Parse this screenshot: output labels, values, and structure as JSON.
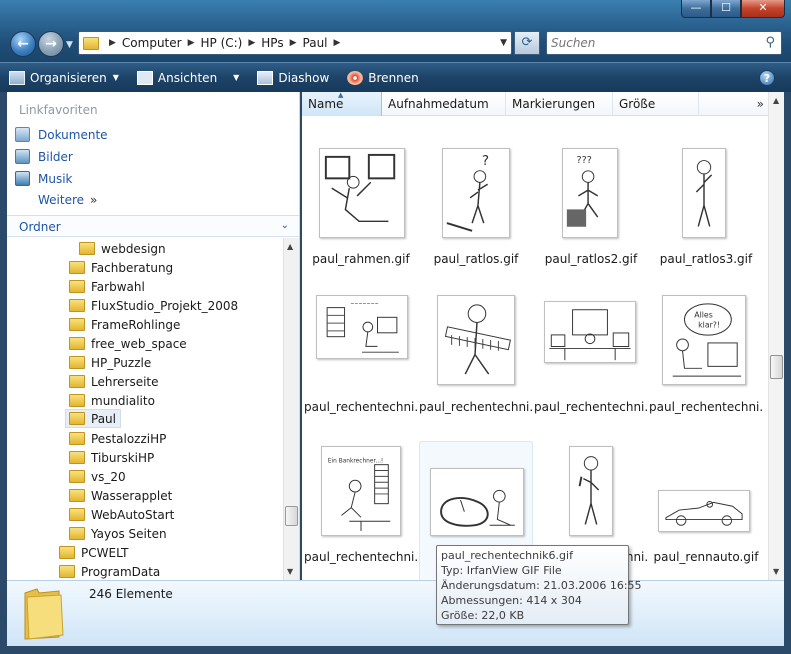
{
  "window": {
    "controls": {
      "minimize": "—",
      "maximize": "☐",
      "close": "✕"
    }
  },
  "address": {
    "crumbs": [
      "Computer",
      "HP (C:)",
      "HPs",
      "Paul"
    ]
  },
  "search": {
    "placeholder": "Suchen"
  },
  "toolbar": {
    "organize": "Organisieren",
    "views": "Ansichten",
    "slideshow": "Diashow",
    "burn": "Brennen",
    "help": "?"
  },
  "favorites": {
    "header": "Linkfavoriten",
    "items": [
      "Dokumente",
      "Bilder",
      "Musik"
    ],
    "more": "Weitere"
  },
  "folders": {
    "header": "Ordner",
    "tree": [
      "webdesign",
      "Fachberatung",
      "Farbwahl",
      "FluxStudio_Projekt_2008",
      "FrameRohlinge",
      "free_web_space",
      "HP_Puzzle",
      "Lehrerseite",
      "mundialito",
      "Paul",
      "PestalozziHP",
      "TiburskiHP",
      "vs_20",
      "Wasserapplet",
      "WebAutoStart",
      "Yayos Seiten",
      "PCWELT",
      "ProgramData"
    ],
    "selected": "Paul"
  },
  "columns": [
    "Name",
    "Aufnahmedatum",
    "Markierungen",
    "Größe"
  ],
  "files": [
    "paul_rahmen.gif",
    "paul_ratlos.gif",
    "paul_ratlos2.gif",
    "paul_ratlos3.gif",
    "paul_rechentechni...",
    "paul_rechentechni...",
    "paul_rechentechni...",
    "paul_rechentechni...",
    "paul_rechentechni...",
    "",
    "paul_rechentechni...",
    "paul_rennauto.gif"
  ],
  "tooltip": {
    "name": "paul_rechentechnik6.gif",
    "type": "Typ: IrfanView GIF File",
    "modified": "Änderungsdatum: 21.03.2006 16:55",
    "dimensions": "Abmessungen: 414 x 304",
    "size": "Größe: 22,0 KB"
  },
  "details": {
    "count": "246 Elemente"
  }
}
